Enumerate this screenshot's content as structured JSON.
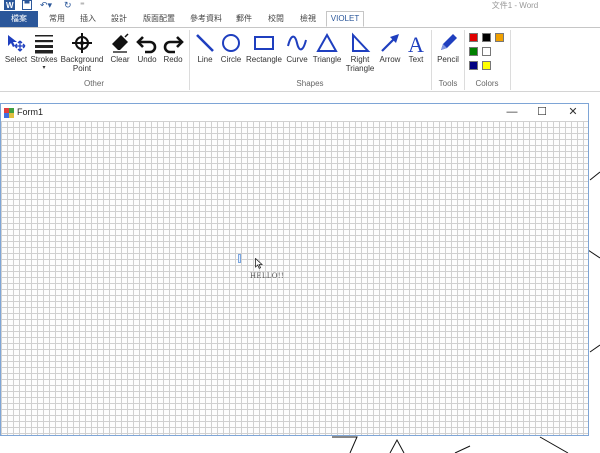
{
  "app": {
    "doc_title": "文件1 - Word",
    "quick_access": {
      "word_icon": "word-logo-icon",
      "save_icon": "save-icon",
      "undo_icon": "undo-icon",
      "redo_icon": "redo-icon"
    }
  },
  "tabs": [
    "檔案",
    "常用",
    "插入",
    "設計",
    "版面配置",
    "參考資料",
    "郵件",
    "校閱",
    "檢視",
    "VIOLET"
  ],
  "ribbon": {
    "other": {
      "label": "Other",
      "buttons": {
        "select": "Select",
        "strokes": "Strokes",
        "background_point_1": "Background",
        "background_point_2": "Point",
        "clear": "Clear",
        "undo": "Undo",
        "redo": "Redo"
      }
    },
    "shapes": {
      "label": "Shapes",
      "buttons": {
        "line": "Line",
        "circle": "Circle",
        "rectangle": "Rectangle",
        "curve": "Curve",
        "triangle": "Triangle",
        "right_triangle_1": "Right",
        "right_triangle_2": "Triangle",
        "arrow": "Arrow",
        "text": "Text"
      }
    },
    "tools": {
      "label": "Tools",
      "pencil": "Pencil"
    },
    "colors": {
      "label": "Colors",
      "swatches": [
        "#e00000",
        "#000000",
        "#f0a000",
        "#008000",
        "#ffffff",
        "#000080",
        "#ffff00"
      ]
    }
  },
  "form": {
    "title": "Form1",
    "controls": {
      "minimize": "—",
      "maximize": "☐",
      "close": "✕"
    },
    "canvas_text": "HELLO!!"
  },
  "colors": {
    "accent": "#2b579a",
    "shape_blue": "#1f3fbf",
    "grid": "#d0d0d0"
  }
}
